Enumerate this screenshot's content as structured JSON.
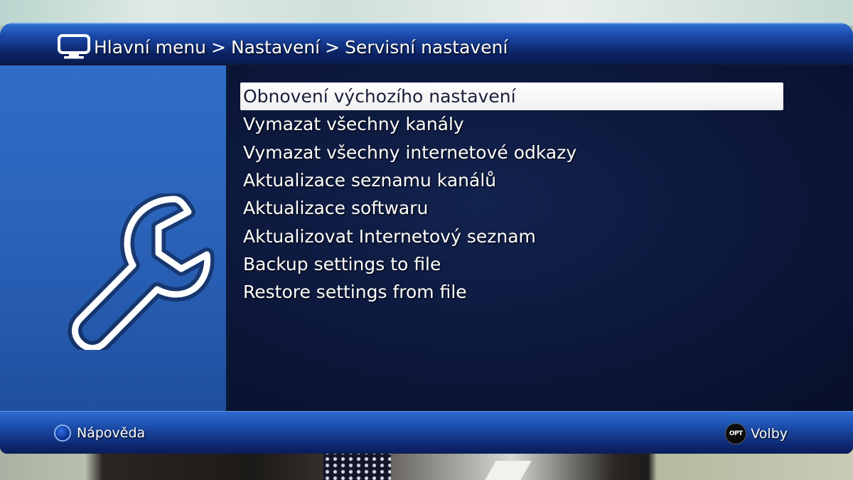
{
  "header": {
    "icon": "tv-icon",
    "breadcrumb": [
      "Hlavní menu",
      "Nastavení",
      "Servisní nastavení"
    ],
    "separator": ">"
  },
  "side_panel": {
    "icon": "wrench-icon"
  },
  "menu": {
    "selected_index": 0,
    "items": [
      "Obnovení výchozího nastavení",
      "Vymazat všechny kanály",
      "Vymazat všechny internetové odkazy",
      "Aktualizace seznamu kanálů",
      "Aktualizace softwaru",
      "Aktualizovat Internetový seznam",
      "Backup settings to file",
      "Restore settings from file"
    ]
  },
  "footer": {
    "help_label": "Nápověda",
    "options_button": "OPT",
    "options_label": "Volby"
  },
  "colors": {
    "header_blue": "#1a48a8",
    "panel_blue": "#2a62b8",
    "menu_background": "#0b1638",
    "selected_bg": "#ffffff",
    "selected_text": "#1a1f3a"
  }
}
